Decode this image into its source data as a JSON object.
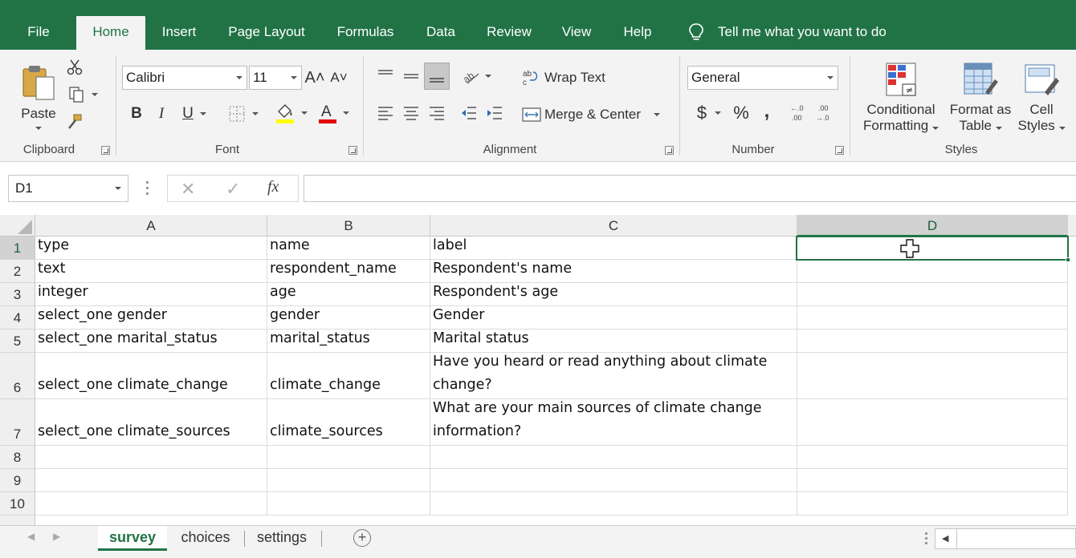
{
  "menu": {
    "tabs": [
      "File",
      "Home",
      "Insert",
      "Page Layout",
      "Formulas",
      "Data",
      "Review",
      "View",
      "Help"
    ],
    "active": "Home",
    "tell_me": "Tell me what you want to do"
  },
  "ribbon": {
    "clipboard": {
      "paste_label": "Paste",
      "group_label": "Clipboard"
    },
    "font": {
      "font_name": "Calibri",
      "font_size": "11",
      "group_label": "Font",
      "highlight_color": "#ffff00",
      "font_color": "#e00000"
    },
    "alignment": {
      "wrap_text": "Wrap Text",
      "merge_center": "Merge & Center",
      "group_label": "Alignment"
    },
    "number": {
      "format": "General",
      "currency": "$",
      "percent": "%",
      "comma": ",",
      "group_label": "Number"
    },
    "styles": {
      "conditional_1": "Conditional",
      "conditional_2": "Formatting",
      "format_table_1": "Format as",
      "format_table_2": "Table",
      "cell_styles_1": "Cell",
      "cell_styles_2": "Styles",
      "group_label": "Styles"
    }
  },
  "formula_bar": {
    "name_box": "D1",
    "fx": "fx",
    "formula": ""
  },
  "sheet": {
    "columns": [
      "A",
      "B",
      "C",
      "D"
    ],
    "selected_column": "D",
    "selected_row": "1",
    "row_numbers": [
      "1",
      "2",
      "3",
      "4",
      "5",
      "6",
      "7",
      "8",
      "9",
      "10"
    ],
    "rows": [
      [
        "type",
        "name",
        "label",
        ""
      ],
      [
        "text",
        "respondent_name",
        "Respondent's name",
        ""
      ],
      [
        "integer",
        "age",
        "Respondent's age",
        ""
      ],
      [
        "select_one gender",
        "gender",
        "Gender",
        ""
      ],
      [
        "select_one marital_status",
        "marital_status",
        "Marital status",
        ""
      ],
      [
        "select_one climate_change",
        "climate_change",
        "Have you heard or read anything about climate change?",
        ""
      ],
      [
        "select_one climate_sources",
        "climate_sources",
        "What are your main sources of climate change information?",
        ""
      ],
      [
        "",
        "",
        "",
        ""
      ],
      [
        "",
        "",
        "",
        ""
      ],
      [
        "",
        "",
        "",
        ""
      ]
    ]
  },
  "sheet_tabs": {
    "tabs": [
      "survey",
      "choices",
      "settings"
    ],
    "active": "survey"
  },
  "colors": {
    "accent": "#217346"
  }
}
